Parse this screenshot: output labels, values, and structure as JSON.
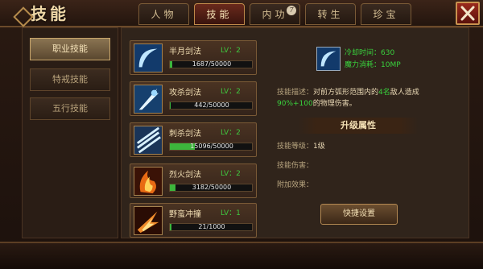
{
  "window": {
    "title": "技能"
  },
  "tabs": [
    {
      "label": "人物",
      "active": false
    },
    {
      "label": "技能",
      "active": true
    },
    {
      "label": "内功",
      "active": false,
      "badge": "7"
    },
    {
      "label": "转生",
      "active": false
    },
    {
      "label": "珍宝",
      "active": false
    }
  ],
  "categories": [
    {
      "label": "职业技能",
      "active": true
    },
    {
      "label": "特戒技能",
      "active": false
    },
    {
      "label": "五行技能",
      "active": false
    }
  ],
  "skills": [
    {
      "name": "半月剑法",
      "level": "LV：2",
      "progress_text": "1687/50000",
      "progress": 0.034,
      "icon": "half-moon-icon"
    },
    {
      "name": "攻杀剑法",
      "level": "LV：2",
      "progress_text": "442/50000",
      "progress": 0.009,
      "icon": "attack-slash-icon"
    },
    {
      "name": "刺杀剑法",
      "level": "LV：2",
      "progress_text": "15096/50000",
      "progress": 0.302,
      "icon": "thrust-slash-icon"
    },
    {
      "name": "烈火剑法",
      "level": "LV：2",
      "progress_text": "3182/50000",
      "progress": 0.064,
      "icon": "flame-sword-icon"
    },
    {
      "name": "野蛮冲撞",
      "level": "LV：1",
      "progress_text": "21/1000",
      "progress": 0.021,
      "icon": "barbarian-charge-icon"
    }
  ],
  "detail": {
    "cooldown": "冷却时间：630",
    "mana_cost": "魔力消耗：10MP",
    "desc_label": "技能描述：",
    "desc_a": "对前方弧形范围内的",
    "desc_b": "4名",
    "desc_c": "敌人造成",
    "desc_d": "90%+100",
    "desc_e": "的物理伤害。",
    "upgrade_header": "升级属性",
    "level_label": "技能等级：",
    "level_value": "1级",
    "damage_label": "技能伤害：",
    "effect_label": "附加效果：",
    "quick_button": "快捷设置"
  },
  "colors": {
    "accent": "#39d23d",
    "panel": "#30241b",
    "active_tab": "#6a2a1c"
  }
}
